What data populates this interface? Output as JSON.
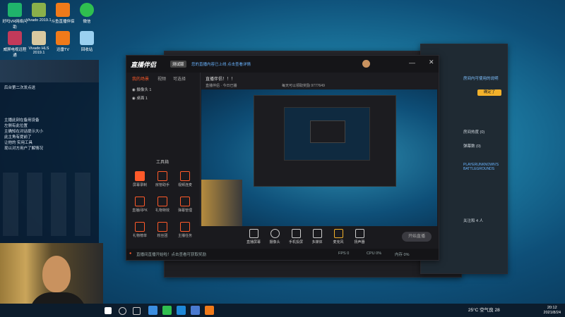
{
  "desktop_icons": [
    {
      "label": "好吗VR网络问助",
      "color": "#1fb36b"
    },
    {
      "label": "Vivado 2019.1",
      "color": "#8ab04a"
    },
    {
      "label": "斗鱼直播伴侣",
      "color": "#f07a1a"
    },
    {
      "label": "微信",
      "color": "#2fbf4f"
    },
    {
      "label": "威屏电视远程通",
      "color": "#c23a5a"
    },
    {
      "label": "Vivado HLS 2019.1",
      "color": "#d8c9a0"
    },
    {
      "label": "迅雷TV",
      "color": "#f07a1a"
    },
    {
      "label": "回收站",
      "color": "#9ad0f0"
    }
  ],
  "overlay": {
    "lines": [
      "后台第二次发点送",
      "主播此刻在备用设备",
      "左侧有此位置",
      "主确知在对话提示大小",
      "此主角有提前了",
      "让他的 实用工具",
      "现以对方用户了解情况"
    ]
  },
  "app": {
    "title": "直播伴侣",
    "badge": "测试版",
    "title_notice": "您的直播内容已上线 点击查看详情",
    "room_title": "直播伴侣！！！",
    "sidebar_tabs": [
      "我的场景",
      "视频",
      "可选择"
    ],
    "scenes": [
      "摄像头 1",
      "桌面 1"
    ],
    "tools_header": "工具箱",
    "tools": [
      {
        "label": "屏幕录制"
      },
      {
        "label": "房管助手"
      },
      {
        "label": "视频连麦"
      },
      {
        "label": "直播间PK"
      },
      {
        "label": "礼物特效"
      },
      {
        "label": "弹幕管理"
      },
      {
        "label": "礼物榜单"
      },
      {
        "label": "粉丝团"
      },
      {
        "label": "主播任务"
      }
    ],
    "stage_info": {
      "line1": "直播伴侣 · 今日已播",
      "line2": "每天可以领取奖励 9777649"
    },
    "controls": [
      {
        "label": "直播屏幕"
      },
      {
        "label": "摄像头"
      },
      {
        "label": "手机投屏"
      },
      {
        "label": "多媒体"
      },
      {
        "label": "麦克风"
      },
      {
        "label": "扬声器"
      }
    ],
    "start_button": "开始直播",
    "status_text": "直播间直播开始啦！点击查看可获取奖励",
    "status_metrics": [
      "FPS 0",
      "CPU 0%",
      "内存 0%"
    ]
  },
  "side_panel": {
    "link": "房间内可使用的说明",
    "items": [
      "房间热度 (0)",
      "弹幕数 (0)",
      "PLAYERUNKNOWN'S BATTLEGROUNDS",
      "关注和 4 人"
    ],
    "button": "确定了"
  },
  "taskbar": {
    "weather": "25°C 空气良 28",
    "time": "20:12",
    "date": "2021/8/24"
  }
}
